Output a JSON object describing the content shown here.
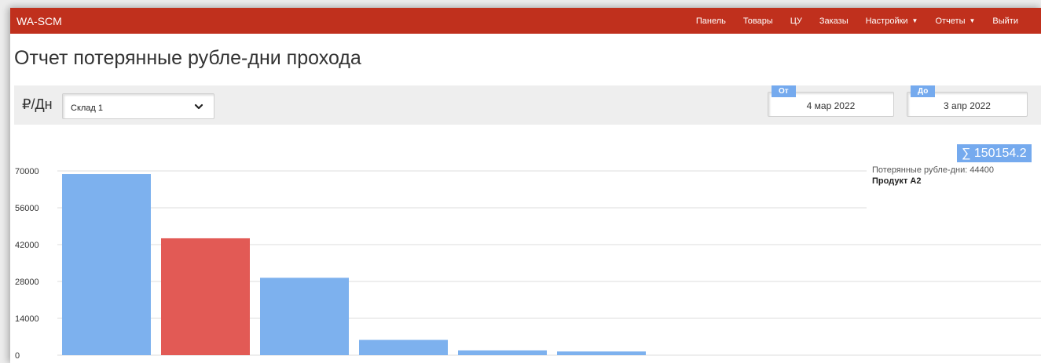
{
  "navbar": {
    "brand": "WA-SCM",
    "items": [
      {
        "label": "Панель",
        "caret": false
      },
      {
        "label": "Товары",
        "caret": false
      },
      {
        "label": "ЦУ",
        "caret": false
      },
      {
        "label": "Заказы",
        "caret": false
      },
      {
        "label": "Настройки",
        "caret": true
      },
      {
        "label": "Отчеты",
        "caret": true
      },
      {
        "label": "Выйти",
        "caret": false
      }
    ]
  },
  "page_title": "Отчет потерянные рубле-дни прохода",
  "filters": {
    "unit_label": "₽/Дн",
    "warehouse": "Склад 1",
    "from_label": "От",
    "from_date": "4 мар 2022",
    "to_label": "До",
    "to_date": "3 апр 2022"
  },
  "summary": {
    "total": "∑ 150154.2"
  },
  "tooltip": {
    "value_text": "Потерянные рубле-дни: 44400",
    "product": "Продукт A2"
  },
  "colors": {
    "navbar": "#c0301d",
    "bar": "#7db1ee",
    "bar_highlight": "#e25a55",
    "accent": "#75aaee"
  },
  "chart_data": {
    "type": "bar",
    "title": "",
    "xlabel": "",
    "ylabel": "",
    "yticks": [
      0,
      14000,
      28000,
      42000,
      56000,
      70000
    ],
    "ylim": [
      0,
      70000
    ],
    "grid": true,
    "values": [
      68800,
      44400,
      29400,
      5800,
      1800,
      1400
    ],
    "highlight_index": 1
  }
}
